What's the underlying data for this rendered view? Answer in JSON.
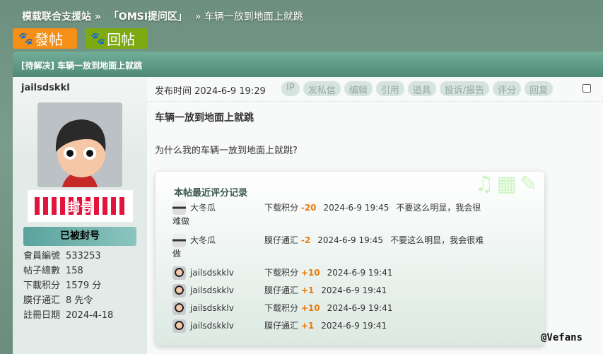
{
  "breadcrumb": [
    "模载联合支援站 »",
    "「OMSI提问区」",
    "» 车辆一放到地面上就跳"
  ],
  "buttons": {
    "new_post": "發帖",
    "reply": "回帖"
  },
  "thread_title": "[待解决] 车辆一放到地面上就跳",
  "author": {
    "name": "jailsdskkl",
    "ban_stamp": "封号",
    "status": "已被封号",
    "info": [
      [
        "會員編號",
        "533253"
      ],
      [
        "帖子總數",
        "158"
      ],
      [
        "下載积分",
        "1579 分"
      ],
      [
        "膜仔通汇",
        "8 先令"
      ],
      [
        "註冊日期",
        "2024-4-18"
      ]
    ]
  },
  "post": {
    "time_label": "发布时间 2024-6-9 19:29",
    "tools": [
      "IP",
      "发私信",
      "编辑",
      "引用",
      "道具",
      "投诉/报告",
      "评分",
      "回复"
    ],
    "title": "车辆一放到地面上就跳",
    "body": "为什么我的车辆一放到地面上就跳?"
  },
  "ratings": {
    "title": "本帖最近评分记录",
    "rows": [
      {
        "user": "大冬瓜",
        "avatar": "cooker",
        "field": "下载积分",
        "value": "-20",
        "date": "2024-6-9 19:45",
        "reason": "不要这么明显，我会很",
        "reason2": "难做"
      },
      {
        "user": "大冬瓜",
        "avatar": "cooker",
        "field": "膜仔通汇",
        "value": "-2",
        "date": "2024-6-9 19:45",
        "reason": "不要这么明显，我会很难",
        "reason2": "做"
      },
      {
        "user": "jailsdskklv",
        "avatar": "kid",
        "field": "下载积分",
        "value": "+10",
        "date": "2024-6-9 19:41",
        "reason": "",
        "reason2": ""
      },
      {
        "user": "jailsdskklv",
        "avatar": "kid",
        "field": "膜仔通汇",
        "value": "+1",
        "date": "2024-6-9 19:41",
        "reason": "",
        "reason2": ""
      },
      {
        "user": "jailsdskklv",
        "avatar": "kid",
        "field": "下载积分",
        "value": "+10",
        "date": "2024-6-9 19:41",
        "reason": "",
        "reason2": ""
      },
      {
        "user": "jailsdskklv",
        "avatar": "kid",
        "field": "膜仔通汇",
        "value": "+1",
        "date": "2024-6-9 19:41",
        "reason": "",
        "reason2": ""
      }
    ]
  },
  "watermark": "@Vefans"
}
